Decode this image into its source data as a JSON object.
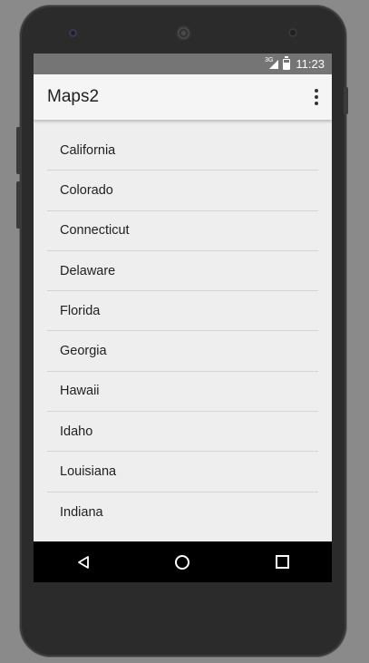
{
  "status_bar": {
    "network": "3G",
    "time": "11:23"
  },
  "app_bar": {
    "title": "Maps2",
    "overflow_icon": "more-vert-icon"
  },
  "states": [
    {
      "label": "California"
    },
    {
      "label": "Colorado"
    },
    {
      "label": "Connecticut"
    },
    {
      "label": "Delaware"
    },
    {
      "label": "Florida"
    },
    {
      "label": "Georgia"
    },
    {
      "label": "Hawaii"
    },
    {
      "label": "Idaho"
    },
    {
      "label": "Louisiana"
    },
    {
      "label": "Indiana"
    }
  ],
  "nav_bar": {
    "back_icon": "back-triangle-icon",
    "home_icon": "home-circle-icon",
    "recents_icon": "recents-square-icon"
  },
  "colors": {
    "status_bar": "#757575",
    "app_bar": "#f5f5f5",
    "background": "#eeeeee",
    "divider": "#d4d4d4",
    "nav_bar": "#000000"
  }
}
